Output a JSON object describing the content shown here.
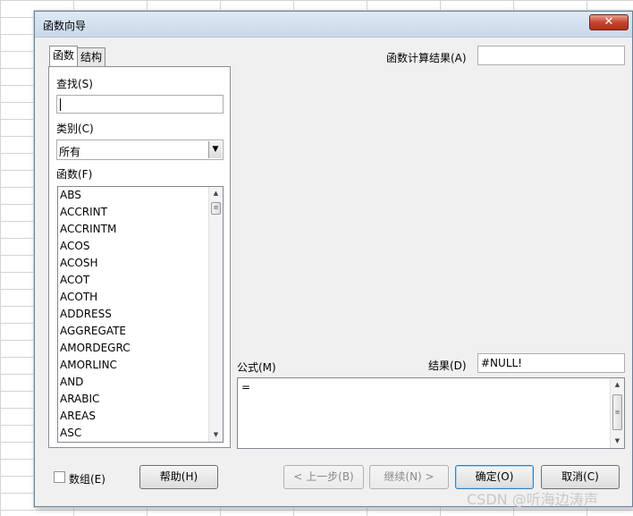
{
  "dialog": {
    "title": "函数向导",
    "close_icon": "✕"
  },
  "tabs": [
    {
      "label": "函数"
    },
    {
      "label": "结构"
    }
  ],
  "search": {
    "label": "查找(S)",
    "value": ""
  },
  "category": {
    "label": "类别(C)",
    "value": "所有",
    "options_visible": [
      "所有"
    ]
  },
  "functions": {
    "label": "函数(F)",
    "items": [
      "ABS",
      "ACCRINT",
      "ACCRINTM",
      "ACOS",
      "ACOSH",
      "ACOT",
      "ACOTH",
      "ADDRESS",
      "AGGREGATE",
      "AMORDEGRC",
      "AMORLINC",
      "AND",
      "ARABIC",
      "AREAS",
      "ASC"
    ]
  },
  "function_result": {
    "label": "函数计算结果(A)",
    "value": ""
  },
  "formula": {
    "label": "公式(M)",
    "value": "="
  },
  "result": {
    "label": "结果(D)",
    "value": "#NULL!"
  },
  "array_checkbox": {
    "label": "数组(E)",
    "checked": false
  },
  "buttons": {
    "help": "帮助(H)",
    "back": "< 上一步(B)",
    "next": "继续(N) >",
    "ok": "确定(O)",
    "cancel": "取消(C)"
  },
  "watermark": "CSDN @听海边涛声",
  "icons": {
    "dropdown": "chevron-down-icon",
    "scroll_up": "scroll-up-arrow-icon",
    "scroll_down": "scroll-down-arrow-icon"
  }
}
